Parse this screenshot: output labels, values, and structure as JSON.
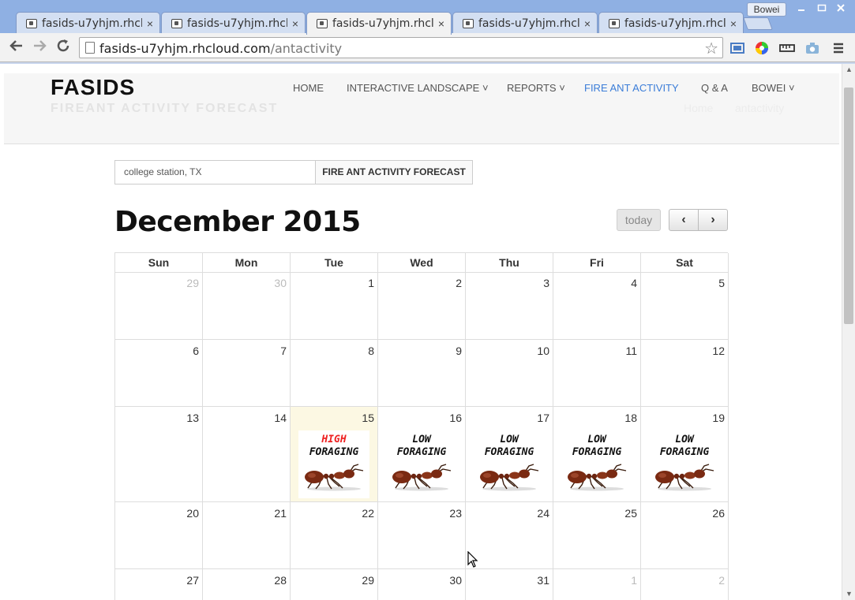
{
  "browser": {
    "tabs": [
      {
        "title": "fasids-u7yhjm.rhclo",
        "active": false
      },
      {
        "title": "fasids-u7yhjm.rhclo",
        "active": false
      },
      {
        "title": "fasids-u7yhjm.rhclo",
        "active": true
      },
      {
        "title": "fasids-u7yhjm.rhclo",
        "active": false
      },
      {
        "title": "fasids-u7yhjm.rhclo",
        "active": false
      }
    ],
    "tab_close_glyph": "×",
    "profile_name": "Bowei",
    "url_host": "fasids-u7yhjm.rhcloud.com",
    "url_path": "/antactivity"
  },
  "site": {
    "logo": "FASIDS",
    "subtitle": "FIREANT ACTIVITY FORECAST",
    "nav": [
      {
        "label": "HOME",
        "active": false
      },
      {
        "label": "INTERACTIVE LANDSCAPE",
        "active": false,
        "dropdown": true
      },
      {
        "label": "REPORTS",
        "active": false,
        "dropdown": true
      },
      {
        "label": "FIRE ANT ACTIVITY",
        "active": true
      },
      {
        "label": "Q & A",
        "active": false
      },
      {
        "label": "BOWEI",
        "active": false,
        "dropdown": true
      }
    ],
    "breadcrumb": [
      "Home",
      "antactivity"
    ],
    "accent_color": "#3b7dd8"
  },
  "search": {
    "value": "college station, TX",
    "button_label": "FIRE ANT ACTIVITY FORECAST"
  },
  "calendar": {
    "title": "December 2015",
    "today_label": "today",
    "prev_glyph": "‹",
    "next_glyph": "›",
    "weekdays": [
      "Sun",
      "Mon",
      "Tue",
      "Wed",
      "Thu",
      "Fri",
      "Sat"
    ],
    "weeks": [
      [
        {
          "day": "29",
          "other": true
        },
        {
          "day": "30",
          "other": true
        },
        {
          "day": "1"
        },
        {
          "day": "2"
        },
        {
          "day": "3"
        },
        {
          "day": "4"
        },
        {
          "day": "5"
        }
      ],
      [
        {
          "day": "6"
        },
        {
          "day": "7"
        },
        {
          "day": "8"
        },
        {
          "day": "9"
        },
        {
          "day": "10"
        },
        {
          "day": "11"
        },
        {
          "day": "12"
        }
      ],
      [
        {
          "day": "13"
        },
        {
          "day": "14"
        },
        {
          "day": "15",
          "today": true,
          "event": {
            "level": "HIGH",
            "text": "FORAGING"
          }
        },
        {
          "day": "16",
          "event": {
            "level": "LOW",
            "text": "FORAGING"
          }
        },
        {
          "day": "17",
          "event": {
            "level": "LOW",
            "text": "FORAGING"
          }
        },
        {
          "day": "18",
          "event": {
            "level": "LOW",
            "text": "FORAGING"
          }
        },
        {
          "day": "19",
          "event": {
            "level": "LOW",
            "text": "FORAGING"
          }
        }
      ],
      [
        {
          "day": "20"
        },
        {
          "day": "21"
        },
        {
          "day": "22"
        },
        {
          "day": "23"
        },
        {
          "day": "24"
        },
        {
          "day": "25"
        },
        {
          "day": "26"
        }
      ],
      [
        {
          "day": "27"
        },
        {
          "day": "28"
        },
        {
          "day": "29"
        },
        {
          "day": "30"
        },
        {
          "day": "31"
        },
        {
          "day": "1",
          "other": true
        },
        {
          "day": "2",
          "other": true
        }
      ]
    ],
    "high_color": "#e22222"
  }
}
